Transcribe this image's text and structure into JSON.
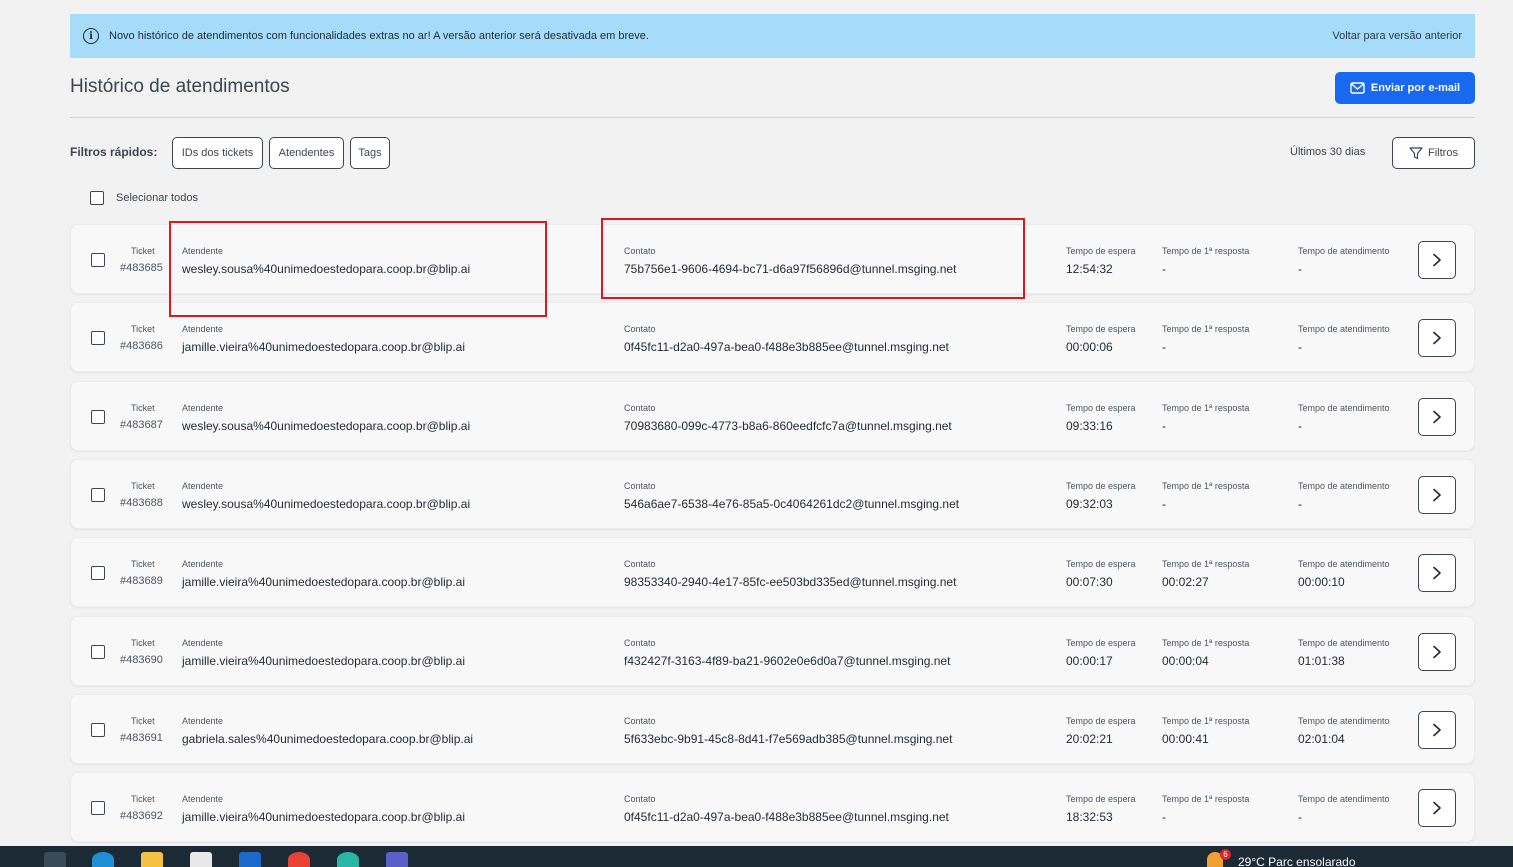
{
  "banner": {
    "info_icon": "info-icon",
    "message": "Novo histórico de atendimentos com funcionalidades extras no ar! A versão anterior será desativada em breve.",
    "back_link": "Voltar para versão anterior"
  },
  "header": {
    "title": "Histórico de atendimentos",
    "email_button": "Enviar por e-mail"
  },
  "filters": {
    "label": "Filtros rápidos:",
    "chips": [
      "IDs dos tickets",
      "Atendentes",
      "Tags"
    ],
    "period": "Últimos 30 dias",
    "filters_button": "Filtros"
  },
  "select_all": "Selecionar todos",
  "columns": {
    "ticket": "Ticket",
    "attendant": "Atendente",
    "contact": "Contato",
    "wait": "Tempo de espera",
    "first_response": "Tempo de 1ª resposta",
    "service": "Tempo de atendimento"
  },
  "rows": [
    {
      "ticket": "#483685",
      "attendant": "wesley.sousa%40unimedoestedopara.coop.br@blip.ai",
      "contact": "75b756e1-9606-4694-bc71-d6a97f56896d@tunnel.msging.net",
      "wait": "12:54:32",
      "first_response": "-",
      "service": "-"
    },
    {
      "ticket": "#483686",
      "attendant": "jamille.vieira%40unimedoestedopara.coop.br@blip.ai",
      "contact": "0f45fc11-d2a0-497a-bea0-f488e3b885ee@tunnel.msging.net",
      "wait": "00:00:06",
      "first_response": "-",
      "service": "-"
    },
    {
      "ticket": "#483687",
      "attendant": "wesley.sousa%40unimedoestedopara.coop.br@blip.ai",
      "contact": "70983680-099c-4773-b8a6-860eedfcfc7a@tunnel.msging.net",
      "wait": "09:33:16",
      "first_response": "-",
      "service": "-"
    },
    {
      "ticket": "#483688",
      "attendant": "wesley.sousa%40unimedoestedopara.coop.br@blip.ai",
      "contact": "546a6ae7-6538-4e76-85a5-0c4064261dc2@tunnel.msging.net",
      "wait": "09:32:03",
      "first_response": "-",
      "service": "-"
    },
    {
      "ticket": "#483689",
      "attendant": "jamille.vieira%40unimedoestedopara.coop.br@blip.ai",
      "contact": "98353340-2940-4e17-85fc-ee503bd335ed@tunnel.msging.net",
      "wait": "00:07:30",
      "first_response": "00:02:27",
      "service": "00:00:10"
    },
    {
      "ticket": "#483690",
      "attendant": "jamille.vieira%40unimedoestedopara.coop.br@blip.ai",
      "contact": "f432427f-3163-4f89-ba21-9602e0e6d0a7@tunnel.msging.net",
      "wait": "00:00:17",
      "first_response": "00:00:04",
      "service": "01:01:38"
    },
    {
      "ticket": "#483691",
      "attendant": "gabriela.sales%40unimedoestedopara.coop.br@blip.ai",
      "contact": "5f633ebc-9b91-45c8-8d41-f7e569adb385@tunnel.msging.net",
      "wait": "20:02:21",
      "first_response": "00:00:41",
      "service": "02:01:04"
    },
    {
      "ticket": "#483692",
      "attendant": "jamille.vieira%40unimedoestedopara.coop.br@blip.ai",
      "contact": "0f45fc11-d2a0-497a-bea0-f488e3b885ee@tunnel.msging.net",
      "wait": "18:32:53",
      "first_response": "-",
      "service": "-"
    }
  ],
  "taskbar": {
    "weather": "29°C  Parc ensolarado",
    "notification_count": "6"
  },
  "colors": {
    "banner_bg": "#a6dcfa",
    "primary_button": "#1968f0",
    "highlight": "#e0151d",
    "taskbar": "#1c2a36"
  }
}
